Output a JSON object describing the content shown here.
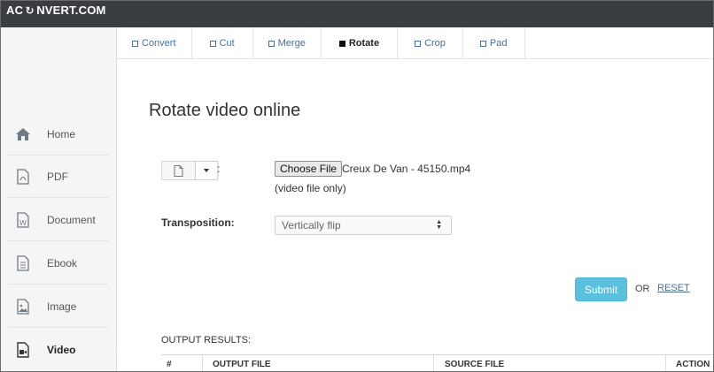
{
  "app": {
    "logo_left": "AC",
    "logo_right": "NVERT.COM"
  },
  "sidebar": {
    "items": [
      {
        "label": "Home",
        "icon": "home-icon"
      },
      {
        "label": "PDF",
        "icon": "pdf-icon"
      },
      {
        "label": "Document",
        "icon": "document-icon"
      },
      {
        "label": "Ebook",
        "icon": "ebook-icon"
      },
      {
        "label": "Image",
        "icon": "image-icon"
      },
      {
        "label": "Video",
        "icon": "video-icon",
        "active": true
      }
    ]
  },
  "tabs": [
    {
      "label": "Convert"
    },
    {
      "label": "Cut"
    },
    {
      "label": "Merge"
    },
    {
      "label": "Rotate",
      "active": true
    },
    {
      "label": "Crop"
    },
    {
      "label": "Pad"
    }
  ],
  "main": {
    "title": "Rotate video online",
    "file_label_suffix": ":",
    "choose_file_label": "Choose File",
    "file_name": "Creux De Van - 45150.mp4",
    "file_hint": "(video file only)",
    "transposition_label": "Transposition:",
    "transposition_value": "Vertically flip",
    "submit_label": "Submit",
    "or_label": "OR",
    "reset_label": "RESET"
  },
  "output": {
    "title": "OUTPUT RESULTS:",
    "columns": [
      "#",
      "OUTPUT FILE",
      "SOURCE FILE",
      "ACTION"
    ]
  },
  "colors": {
    "topbar": "#3a3e43",
    "link": "#4a6f95",
    "submit": "#5bc0de"
  }
}
